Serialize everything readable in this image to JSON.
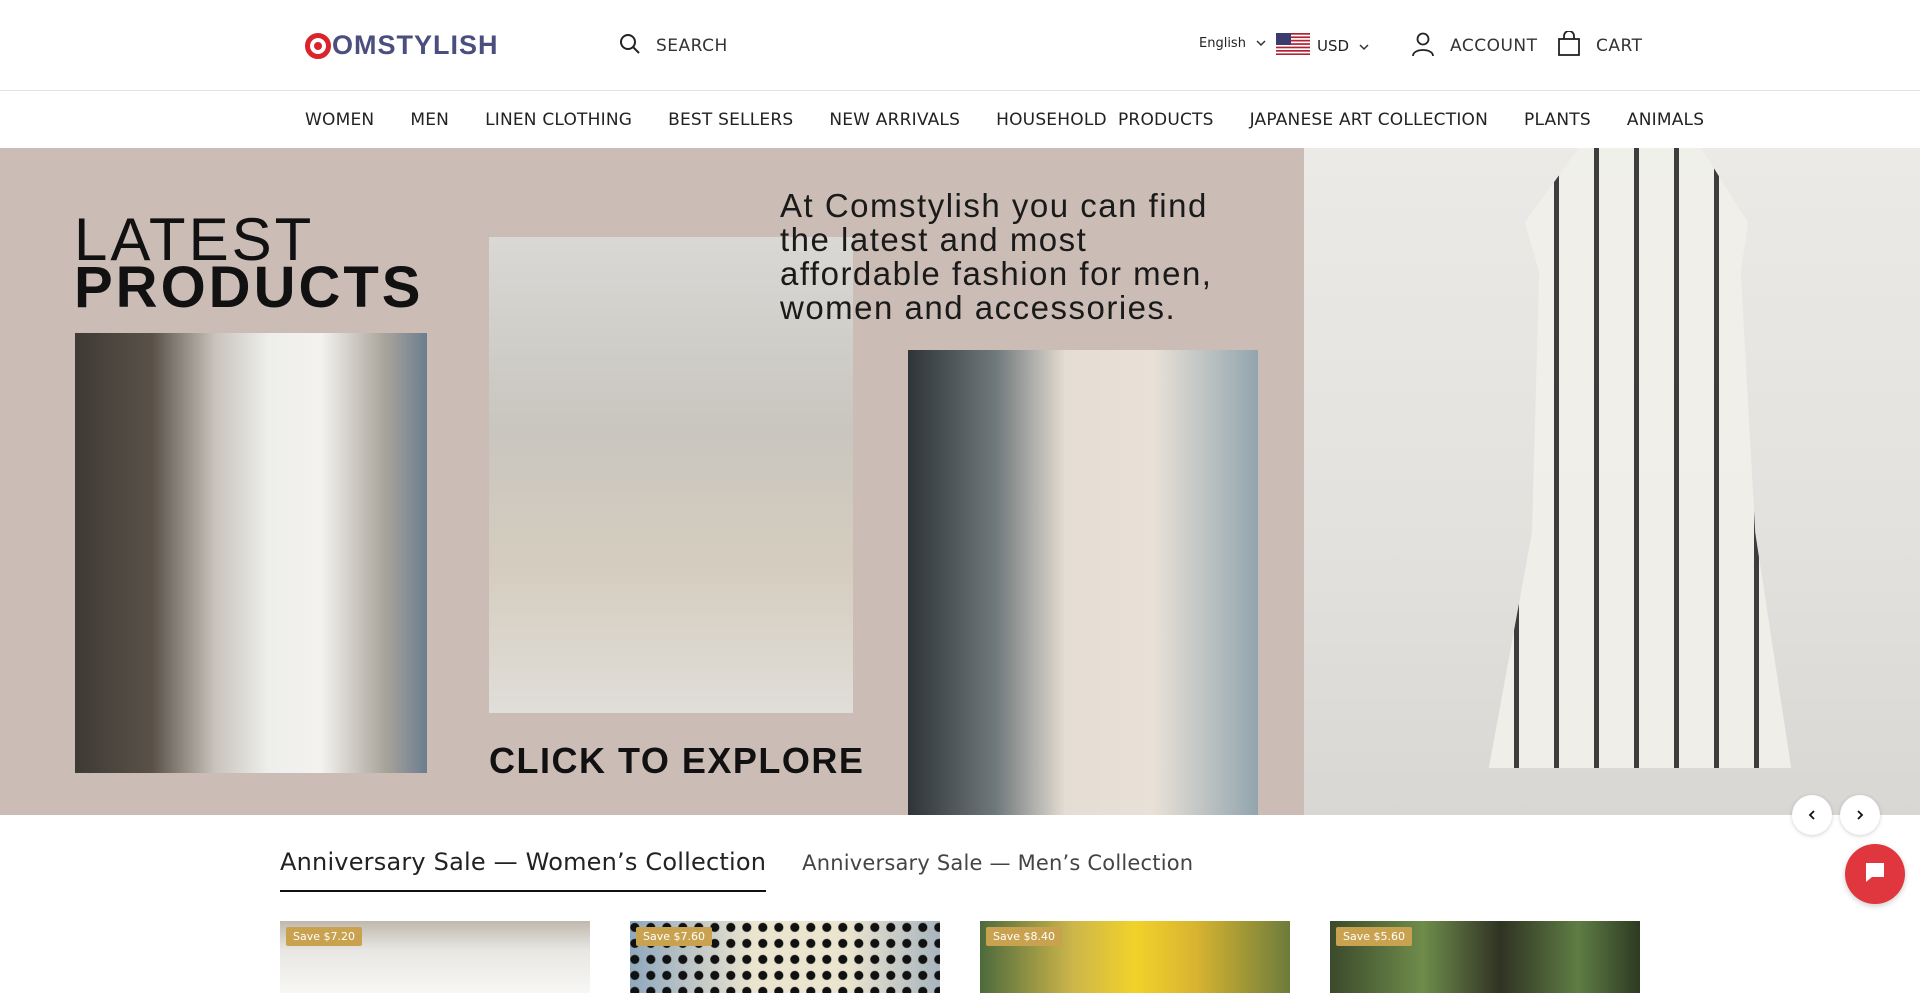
{
  "header": {
    "logo_text": "OMSTYLISH",
    "search_label": "SEARCH",
    "language": "English",
    "currency": "USD",
    "account_label": "ACCOUNT",
    "cart_label": "CART"
  },
  "nav": {
    "items": [
      "WOMEN",
      "MEN",
      "LINEN CLOTHING",
      "BEST SELLERS",
      "NEW ARRIVALS",
      "HOUSEHOLD  PRODUCTS",
      "JAPANESE ART COLLECTION",
      "PLANTS",
      "ANIMALS"
    ]
  },
  "hero": {
    "title_line1": "LATEST",
    "title_line2": "PRODUCTS",
    "tagline": "At Comstylish you can find the latest and most affordable fashion for men, women and accessories.",
    "cta": "CLICK TO EXPLORE"
  },
  "tabs": [
    {
      "label": "Anniversary Sale — Women’s Collection",
      "active": true
    },
    {
      "label": "Anniversary Sale — Men’s Collection",
      "active": false
    }
  ],
  "products": [
    {
      "badge": "Save $7.20"
    },
    {
      "badge": "Save $7.60"
    },
    {
      "badge": "Save $8.40"
    },
    {
      "badge": "Save $5.60"
    }
  ],
  "icons": {
    "logo": "logo-c-mark",
    "search": "search-icon",
    "account": "user-icon",
    "cart": "shopping-bag-icon",
    "flag": "us-flag-icon",
    "prev": "chevron-left-icon",
    "next": "chevron-right-icon",
    "chat": "chat-icon"
  },
  "colors": {
    "brand_red": "#d9232d",
    "logo_text": "#4a4f7e",
    "banner_bg": "#cbbdb5",
    "badge": "#c9a24f",
    "chat_button": "#e0373e"
  }
}
